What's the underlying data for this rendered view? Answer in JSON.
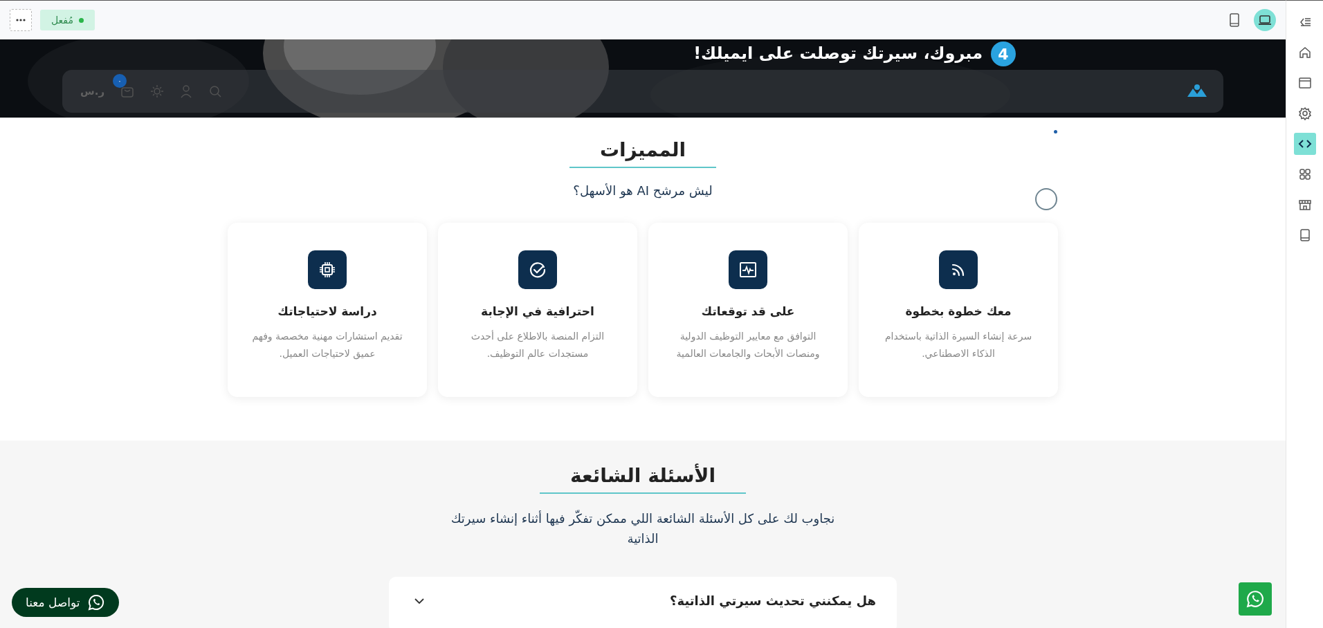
{
  "toolbar": {
    "status": {
      "label": "مُفعل",
      "active": true
    },
    "devices": [
      {
        "kind": "tablet",
        "selected": false
      },
      {
        "kind": "laptop",
        "selected": true
      }
    ]
  },
  "sidebar": {
    "items": [
      {
        "kind": "collapse",
        "selected": false
      },
      {
        "kind": "home",
        "selected": false
      },
      {
        "kind": "window",
        "selected": false
      },
      {
        "kind": "settings",
        "selected": false
      },
      {
        "kind": "code",
        "selected": true
      },
      {
        "kind": "grid",
        "selected": false
      },
      {
        "kind": "store",
        "selected": false
      },
      {
        "kind": "tablet",
        "selected": false
      }
    ]
  },
  "hero": {
    "step": "4",
    "title": "مبروك، سيرتك توصلت على ايميلك!"
  },
  "nav": {
    "cart_count": "٠",
    "currency": "ر.س"
  },
  "features": {
    "title": "المميزات",
    "subtitle": "ليش مرشح AI هو الأسهل؟",
    "items": [
      {
        "kind": "rss",
        "title": "معك خطوة بخطوة",
        "text": "سرعة إنشاء السيرة الذاتية باستخدام الذكاء الاصطناعي."
      },
      {
        "kind": "pulse",
        "title": "على قد توقعاتك",
        "text": "التوافق مع معايير التوظيف الدولية ومنصات الأبحاث والجامعات العالمية"
      },
      {
        "kind": "check",
        "title": "احترافية في الإجابة",
        "text": "التزام المنصة بالاطلاع على أحدث مستجدات عالم التوظيف."
      },
      {
        "kind": "chip",
        "title": "دراسة لاحتياجاتك",
        "text": "تقديم استشارات مهنية مخصصة وفهم عميق لاحتياجات العميل."
      }
    ]
  },
  "faq": {
    "title": "الأسئلة الشائعة",
    "subtitle": "نجاوب لك على كل الأسئلة الشائعة اللي ممكن تفكّر فيها أثناء إنشاء سيرتك الذاتية",
    "questions": [
      {
        "question": "هل يمكنني تحديث سيرتي الذاتية؟",
        "expanded": false
      }
    ]
  },
  "contact_button": {
    "label": "تواصل معنا"
  }
}
